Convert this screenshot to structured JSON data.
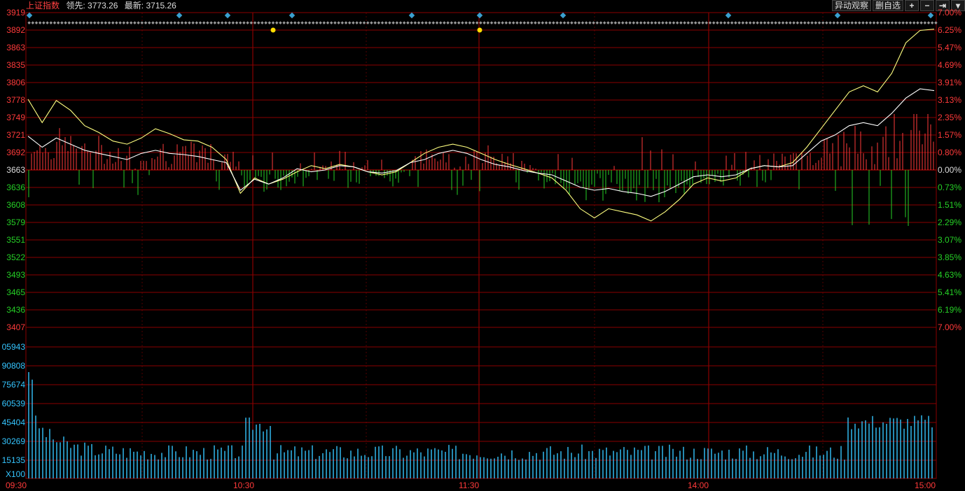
{
  "header": {
    "index_name": "上证指数",
    "lead_label": "领先:",
    "lead_value": "3773.26",
    "latest_label": "最新:",
    "latest_value": "3715.26"
  },
  "toolbar": {
    "anomaly_label": "异动观察",
    "delete_label": "删自选",
    "zoom_in": "+",
    "zoom_out": "−",
    "goto_end": "⇥",
    "menu": "▾"
  },
  "price_axis": {
    "left": [
      "3919",
      "3892",
      "3863",
      "3835",
      "3806",
      "3778",
      "3749",
      "3721",
      "3692",
      "3663",
      "3636",
      "3608",
      "3579",
      "3551",
      "3522",
      "3493",
      "3465",
      "3436",
      "3407"
    ],
    "right": [
      "7.00%",
      "6.25%",
      "5.47%",
      "4.69%",
      "3.91%",
      "3.13%",
      "2.35%",
      "1.57%",
      "0.80%",
      "0.00%",
      "0.73%",
      "1.51%",
      "2.29%",
      "3.07%",
      "3.85%",
      "4.63%",
      "5.41%",
      "6.19%",
      "7.00%"
    ]
  },
  "volume_axis": {
    "labels": [
      "05943",
      "90808",
      "75674",
      "60539",
      "45404",
      "30269",
      "15135"
    ],
    "unit": "X100"
  },
  "time_axis": [
    "09:30",
    "10:30",
    "11:30",
    "14:00",
    "15:00"
  ],
  "colors": {
    "up": "#ff3a3a",
    "down": "#26d026",
    "price_line": "#ffffff",
    "lead_line": "#ffff80",
    "volume": "#35c5ff",
    "grid": "#8a0000",
    "marker": "#3aa0d0"
  },
  "chart_data": {
    "type": "line",
    "title": "上证指数",
    "x_domain": [
      "09:30",
      "15:00"
    ],
    "prev_close": 3663,
    "ylim": [
      3407,
      3919
    ],
    "series": [
      {
        "name": "领先",
        "points": [
          [
            0,
            3778
          ],
          [
            1,
            3740
          ],
          [
            2,
            3776
          ],
          [
            3,
            3760
          ],
          [
            4,
            3735
          ],
          [
            5,
            3724
          ],
          [
            6,
            3710
          ],
          [
            7,
            3705
          ],
          [
            8,
            3715
          ],
          [
            9,
            3730
          ],
          [
            10,
            3722
          ],
          [
            11,
            3712
          ],
          [
            12,
            3710
          ],
          [
            13,
            3700
          ],
          [
            14,
            3680
          ],
          [
            15,
            3625
          ],
          [
            16,
            3650
          ],
          [
            17,
            3640
          ],
          [
            18,
            3648
          ],
          [
            19,
            3660
          ],
          [
            20,
            3670
          ],
          [
            21,
            3665
          ],
          [
            22,
            3672
          ],
          [
            23,
            3668
          ],
          [
            24,
            3660
          ],
          [
            25,
            3655
          ],
          [
            26,
            3660
          ],
          [
            27,
            3675
          ],
          [
            28,
            3690
          ],
          [
            29,
            3700
          ],
          [
            30,
            3705
          ],
          [
            31,
            3700
          ],
          [
            32,
            3690
          ],
          [
            33,
            3680
          ],
          [
            34,
            3672
          ],
          [
            35,
            3665
          ],
          [
            36,
            3658
          ],
          [
            37,
            3650
          ],
          [
            38,
            3630
          ],
          [
            39,
            3600
          ],
          [
            40,
            3585
          ],
          [
            41,
            3600
          ],
          [
            42,
            3595
          ],
          [
            43,
            3590
          ],
          [
            44,
            3580
          ],
          [
            45,
            3595
          ],
          [
            46,
            3615
          ],
          [
            47,
            3640
          ],
          [
            48,
            3650
          ],
          [
            49,
            3645
          ],
          [
            50,
            3650
          ],
          [
            51,
            3665
          ],
          [
            52,
            3670
          ],
          [
            53,
            3668
          ],
          [
            54,
            3675
          ],
          [
            55,
            3700
          ],
          [
            56,
            3730
          ],
          [
            57,
            3760
          ],
          [
            58,
            3790
          ],
          [
            59,
            3800
          ],
          [
            60,
            3790
          ],
          [
            61,
            3820
          ],
          [
            62,
            3870
          ],
          [
            63,
            3890
          ],
          [
            64,
            3892
          ]
        ]
      },
      {
        "name": "最新",
        "points": [
          [
            0,
            3718
          ],
          [
            1,
            3700
          ],
          [
            2,
            3715
          ],
          [
            3,
            3705
          ],
          [
            4,
            3695
          ],
          [
            5,
            3690
          ],
          [
            6,
            3685
          ],
          [
            7,
            3680
          ],
          [
            8,
            3690
          ],
          [
            9,
            3695
          ],
          [
            10,
            3690
          ],
          [
            11,
            3688
          ],
          [
            12,
            3685
          ],
          [
            13,
            3680
          ],
          [
            14,
            3675
          ],
          [
            15,
            3630
          ],
          [
            16,
            3648
          ],
          [
            17,
            3640
          ],
          [
            18,
            3650
          ],
          [
            19,
            3665
          ],
          [
            20,
            3660
          ],
          [
            21,
            3663
          ],
          [
            22,
            3670
          ],
          [
            23,
            3668
          ],
          [
            24,
            3660
          ],
          [
            25,
            3658
          ],
          [
            26,
            3662
          ],
          [
            27,
            3675
          ],
          [
            28,
            3680
          ],
          [
            29,
            3690
          ],
          [
            30,
            3695
          ],
          [
            31,
            3690
          ],
          [
            32,
            3680
          ],
          [
            33,
            3672
          ],
          [
            34,
            3668
          ],
          [
            35,
            3662
          ],
          [
            36,
            3658
          ],
          [
            37,
            3655
          ],
          [
            38,
            3645
          ],
          [
            39,
            3635
          ],
          [
            40,
            3630
          ],
          [
            41,
            3633
          ],
          [
            42,
            3628
          ],
          [
            43,
            3625
          ],
          [
            44,
            3620
          ],
          [
            45,
            3628
          ],
          [
            46,
            3640
          ],
          [
            47,
            3652
          ],
          [
            48,
            3655
          ],
          [
            49,
            3652
          ],
          [
            50,
            3655
          ],
          [
            51,
            3665
          ],
          [
            52,
            3670
          ],
          [
            53,
            3668
          ],
          [
            54,
            3670
          ],
          [
            55,
            3690
          ],
          [
            56,
            3710
          ],
          [
            57,
            3720
          ],
          [
            58,
            3735
          ],
          [
            59,
            3740
          ],
          [
            60,
            3735
          ],
          [
            61,
            3755
          ],
          [
            62,
            3780
          ],
          [
            63,
            3795
          ],
          [
            64,
            3792
          ]
        ]
      }
    ]
  }
}
